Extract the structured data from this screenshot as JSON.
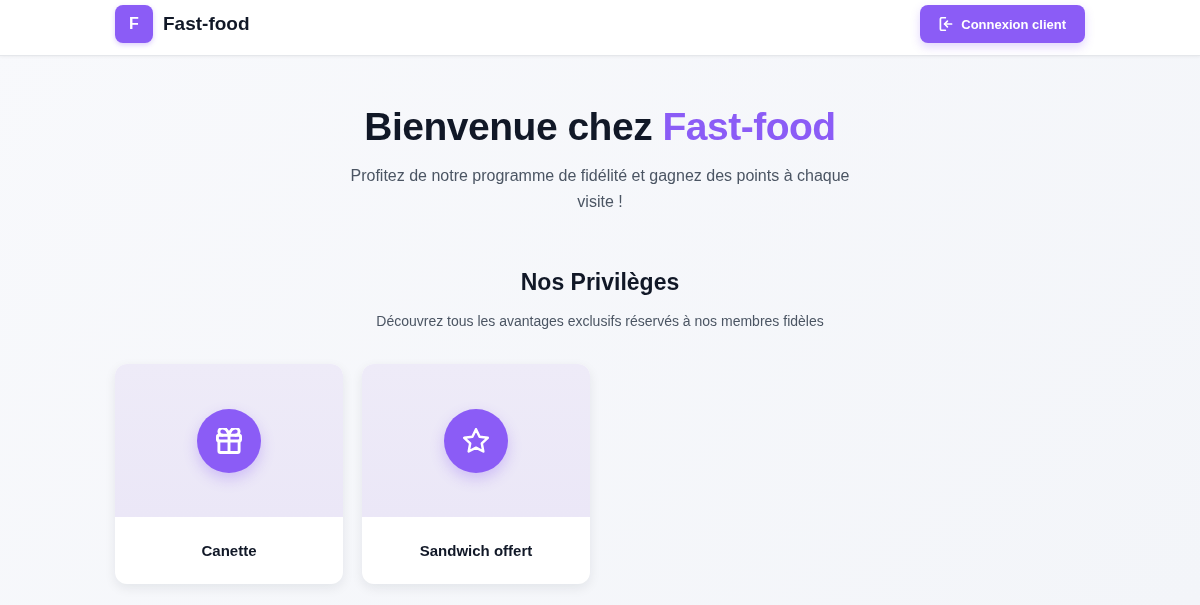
{
  "header": {
    "logo_letter": "F",
    "brand": "Fast-food",
    "login_button": "Connexion client"
  },
  "hero": {
    "title": "Bienvenue chez",
    "title_highlight": "Fast-food",
    "subtitle": "Profitez de notre programme de fidélité et gagnez des points à chaque visite !"
  },
  "privileges": {
    "title": "Nos Privilèges",
    "description": "Découvrez tous les avantages exclusifs réservés à nos membres fidèles",
    "cards": [
      {
        "label": "Canette"
      },
      {
        "label": "Sandwich offert"
      }
    ]
  }
}
